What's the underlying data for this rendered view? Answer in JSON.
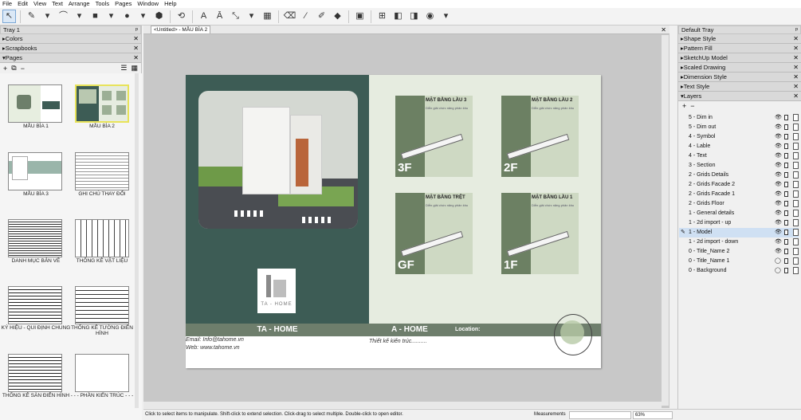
{
  "menu": [
    "File",
    "Edit",
    "View",
    "Text",
    "Arrange",
    "Tools",
    "Pages",
    "Window",
    "Help"
  ],
  "left_tray": {
    "title": "Tray 1",
    "sections": [
      "Colors",
      "Scrapbooks",
      "Pages"
    ],
    "pages": [
      {
        "label": "MẪU BÌA 1",
        "kind": "cover1"
      },
      {
        "label": "MẪU BÌA 2",
        "kind": "cover2",
        "selected": true
      },
      {
        "label": "MẪU BÌA 3",
        "kind": "cover3"
      },
      {
        "label": "GHI CHÚ THAY ĐỔI",
        "kind": "table"
      },
      {
        "label": "DANH MỤC BẢN VẼ",
        "kind": "table"
      },
      {
        "label": "THỐNG KÊ VẬT LIỆU",
        "kind": "table"
      },
      {
        "label": "KÝ HIỆU - QUI ĐỊNH CHUNG",
        "kind": "table"
      },
      {
        "label": "THỐNG KÊ TƯỜNG ĐIỂN HÌNH",
        "kind": "table"
      },
      {
        "label": "THỐNG KÊ SÀN ĐIỂN HÌNH",
        "kind": "table"
      },
      {
        "label": "- - - PHẦN KIẾN TRÚC - - -",
        "kind": "blank"
      }
    ]
  },
  "document": {
    "tab": "<Untitled> - MẪU BÌA 2"
  },
  "sheet": {
    "brand": "TA - HOME",
    "logo_text": "TA - HOME",
    "email": "Email: Info@tahome.vn",
    "web": "Web: www.tahome.vn",
    "bar_center": "A - HOME",
    "location": "Location:",
    "subtitle": "Thiết kế kiến trúc..........",
    "plans": [
      {
        "title": "MẶT BẰNG LẦU 3",
        "sub": "Diễn giải chức năng phân khu",
        "floor": "3F"
      },
      {
        "title": "MẶT BẰNG LẦU 2",
        "sub": "Diễn giải chức năng phân khu",
        "floor": "2F"
      },
      {
        "title": "MẶT BẰNG TRỆT",
        "sub": "Diễn giải chức năng phân khu",
        "floor": "GF"
      },
      {
        "title": "MẶT BẰNG LẦU 1",
        "sub": "Diễn giải chức năng phân khu",
        "floor": "1F"
      }
    ]
  },
  "right_tray": {
    "title": "Default Tray",
    "sections": [
      "Shape Style",
      "Pattern Fill",
      "SketchUp Model",
      "Scaled Drawing",
      "Dimension Style",
      "Text Style",
      "Layers"
    ],
    "layers": [
      {
        "name": "5 - Dim in",
        "visible": true
      },
      {
        "name": "5 - Dim out",
        "visible": true
      },
      {
        "name": "4 - Symbol",
        "visible": true
      },
      {
        "name": "4 - Lable",
        "visible": true
      },
      {
        "name": "4 - Text",
        "visible": true
      },
      {
        "name": "3 - Section",
        "visible": true
      },
      {
        "name": "2 - Grids Details",
        "visible": true
      },
      {
        "name": "2 - Grids Facade 2",
        "visible": true
      },
      {
        "name": "2 - Grids Facade 1",
        "visible": true
      },
      {
        "name": "2 - Grids Floor",
        "visible": true
      },
      {
        "name": "1 - General details",
        "visible": true
      },
      {
        "name": "1 - 2d import - up",
        "visible": true
      },
      {
        "name": "1 - Model",
        "visible": true,
        "active": true
      },
      {
        "name": "1 - 2d import - down",
        "visible": true
      },
      {
        "name": "0 - Title_Name 2",
        "visible": true
      },
      {
        "name": "0 - Title_Name 1",
        "visible": false
      },
      {
        "name": "0 - Background",
        "visible": false
      }
    ]
  },
  "status": {
    "hint": "Click to select items to manipulate. Shift-click to extend selection. Click-drag to select multiple. Double-click to open editor.",
    "measurements_label": "Measurements",
    "zoom": "63%"
  },
  "colors": {
    "dark_green": "#3d5c55",
    "sage": "#6c8063",
    "light_sage": "#e6ece0",
    "bar": "#6e7e6c"
  }
}
